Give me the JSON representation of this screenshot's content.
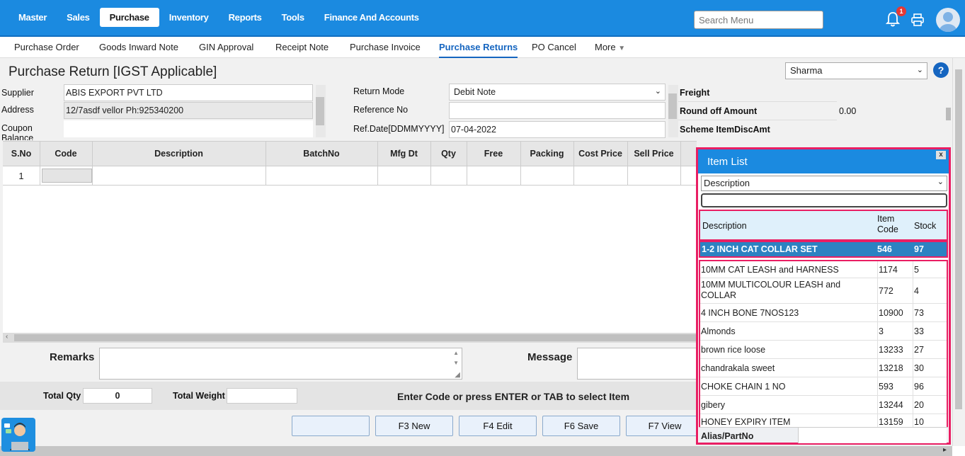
{
  "topnav": {
    "items": [
      "Master",
      "Sales",
      "Purchase",
      "Inventory",
      "Reports",
      "Tools",
      "Finance And Accounts"
    ],
    "active_index": 2,
    "search_placeholder": "Search Menu",
    "notification_count": "1"
  },
  "subnav": {
    "items": [
      "Purchase Order",
      "Goods Inward Note",
      "GIN Approval",
      "Receipt Note",
      "Purchase Invoice",
      "Purchase Returns",
      "PO Cancel",
      "More"
    ],
    "active_index": 5
  },
  "page": {
    "title": "Purchase Return [IGST Applicable]",
    "user": "Sharma",
    "help": "?"
  },
  "form": {
    "supplier_label": "Supplier",
    "supplier_value": "ABIS EXPORT PVT LTD",
    "address_label": "Address",
    "address_value": "12/7asdf vellor Ph:925340200",
    "coupon_label": "Coupon Balance",
    "coupon_value": "",
    "return_mode_label": "Return Mode",
    "return_mode_value": "Debit Note",
    "reference_label": "Reference No",
    "reference_value": "",
    "refdate_label": "Ref.Date[DDMMYYYY]",
    "refdate_value": "07-04-2022",
    "freight_label": "Freight",
    "freight_value": "",
    "roundoff_label": "Round off Amount",
    "roundoff_value": "0.00",
    "scheme_label": "Scheme ItemDiscAmt",
    "scheme_value": ""
  },
  "grid": {
    "columns": [
      "S.No",
      "Code",
      "Description",
      "BatchNo",
      "Mfg Dt",
      "Qty",
      "Free",
      "Packing",
      "Cost Price",
      "Sell Price"
    ],
    "rows": [
      [
        "1",
        "",
        "",
        "",
        "",
        "",
        "",
        "",
        "",
        ""
      ]
    ]
  },
  "footer": {
    "remarks_label": "Remarks",
    "message_label": "Message",
    "total_qty_label": "Total Qty",
    "total_qty_value": "0",
    "total_weight_label": "Total Weight",
    "total_weight_value": "",
    "hint": "Enter Code or press ENTER or TAB to select Item",
    "buttons": [
      "",
      "F3 New",
      "F4 Edit",
      "F6 Save",
      "F7 View"
    ]
  },
  "item_list": {
    "title": "Item List",
    "close": "x",
    "search_by": "Description",
    "search_value": "",
    "headers": [
      "Description",
      "Item Code",
      "Stock"
    ],
    "selected": {
      "description": "1-2 INCH CAT COLLAR SET",
      "code": "546",
      "stock": "97"
    },
    "items": [
      {
        "description": "10MM CAT LEASH and HARNESS",
        "code": "1174",
        "stock": "5"
      },
      {
        "description": "10MM MULTICOLOUR LEASH and COLLAR",
        "code": "772",
        "stock": "4"
      },
      {
        "description": "4 INCH BONE 7NOS123",
        "code": "10900",
        "stock": "73"
      },
      {
        "description": "Almonds",
        "code": "3",
        "stock": "33"
      },
      {
        "description": "brown rice loose",
        "code": "13233",
        "stock": "27"
      },
      {
        "description": "chandrakala sweet",
        "code": "13218",
        "stock": "30"
      },
      {
        "description": "CHOKE CHAIN 1 NO",
        "code": "593",
        "stock": "96"
      },
      {
        "description": "gibery",
        "code": "13244",
        "stock": "20"
      },
      {
        "description": "HONEY EXPIRY ITEM",
        "code": "13159",
        "stock": "10"
      }
    ],
    "alias_label": "Alias/PartNo",
    "alias_value": ""
  },
  "colors": {
    "primary": "#1b8ae0",
    "highlight": "#e91e63",
    "selected_row": "#2c82c2"
  }
}
